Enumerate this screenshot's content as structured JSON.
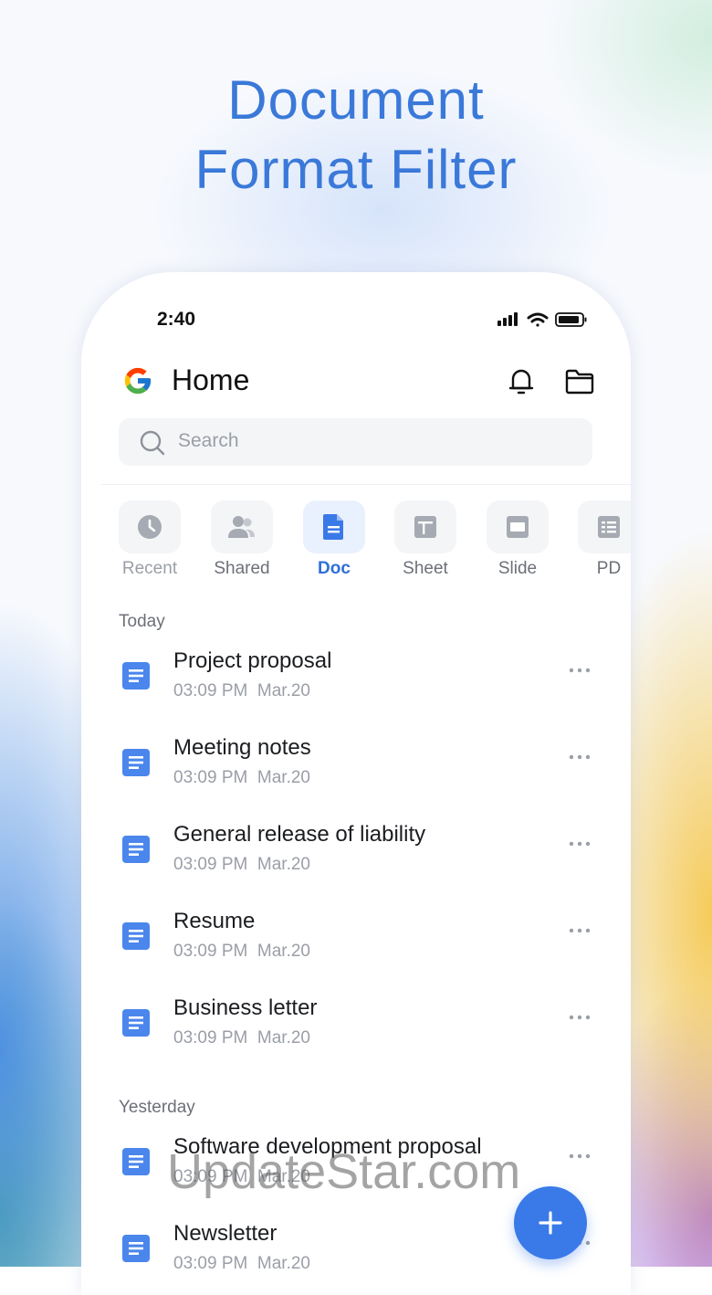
{
  "headline": {
    "line1": "Document",
    "line2": "Format Filter"
  },
  "status_bar": {
    "time": "2:40"
  },
  "header": {
    "title": "Home"
  },
  "search": {
    "placeholder": "Search"
  },
  "tabs": [
    {
      "label": "Recent",
      "icon": "clock-icon"
    },
    {
      "label": "Shared",
      "icon": "people-icon"
    },
    {
      "label": "Doc",
      "icon": "doc-icon",
      "active": true
    },
    {
      "label": "Sheet",
      "icon": "sheet-icon"
    },
    {
      "label": "Slide",
      "icon": "slide-icon"
    },
    {
      "label": "PD",
      "icon": "pdf-icon"
    }
  ],
  "sections": [
    {
      "title": "Today",
      "items": [
        {
          "title": "Project proposal",
          "time": "03:09 PM",
          "date": "Mar.20"
        },
        {
          "title": "Meeting notes",
          "time": "03:09 PM",
          "date": "Mar.20"
        },
        {
          "title": "General release of liability",
          "time": "03:09 PM",
          "date": "Mar.20"
        },
        {
          "title": "Resume",
          "time": "03:09 PM",
          "date": "Mar.20"
        },
        {
          "title": "Business letter",
          "time": "03:09 PM",
          "date": "Mar.20"
        }
      ]
    },
    {
      "title": "Yesterday",
      "items": [
        {
          "title": "Software development proposal",
          "time": "03:09 PM",
          "date": "Mar.20"
        },
        {
          "title": "Newsletter",
          "time": "03:09 PM",
          "date": "Mar.20"
        }
      ]
    }
  ],
  "watermark": "UpdateStar.com",
  "colors": {
    "accent": "#3a79e8",
    "headline": "#3a79d9",
    "doc": "#4a86ec"
  }
}
